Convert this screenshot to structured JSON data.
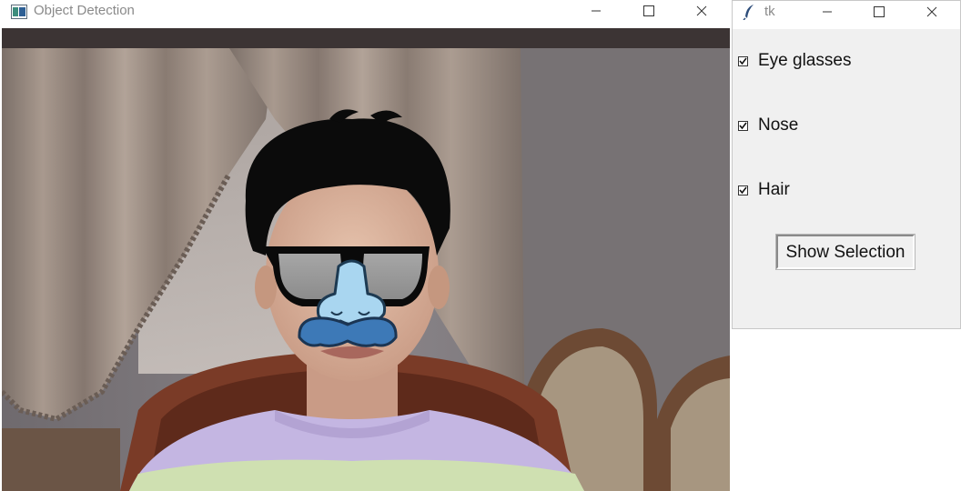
{
  "left_window": {
    "title": "Object Detection",
    "controls": [
      "minimize",
      "maximize",
      "close"
    ]
  },
  "right_window": {
    "title": "tk",
    "controls": [
      "minimize",
      "maximize",
      "close"
    ],
    "checkboxes": [
      {
        "label": "Eye glasses",
        "checked": true
      },
      {
        "label": "Nose",
        "checked": true
      },
      {
        "label": "Hair",
        "checked": true
      }
    ],
    "button_label": "Show Selection"
  },
  "colors": {
    "title_text": "#8a8a8a",
    "tk_panel_bg": "#f0f0f0",
    "mustache": "#3d79b7",
    "nose_overlay": "#a9d6f0",
    "glasses_lens": "#9a9a9a",
    "shirt_lavender": "#c4b6e2",
    "shirt_green": "#cfe0b1"
  },
  "icons": {
    "left_app": "python-window-icon",
    "right_app": "tk-feather-icon"
  }
}
